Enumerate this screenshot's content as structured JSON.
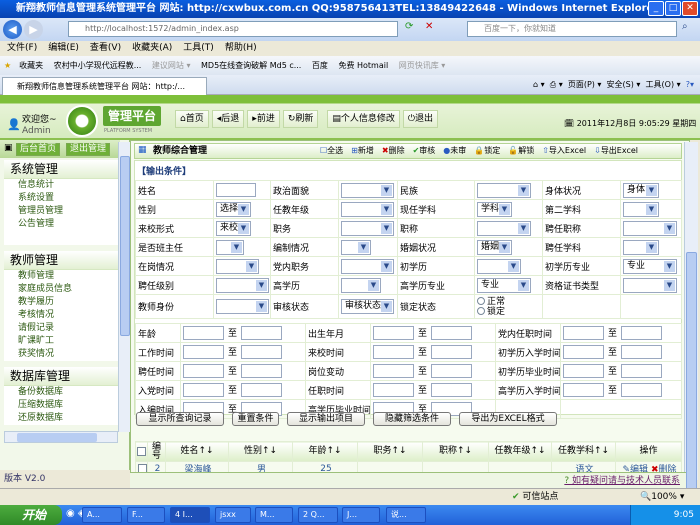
{
  "browser": {
    "title": "新翔教师信息管理系统管理平台 网站: http://cxwbux.com.cn QQ:958756413TEL:13849422648 - Windows Internet Explorer",
    "address": "http://localhost:1572/admin_index.asp",
    "search_placeholder": "百度一下，你就知道",
    "menu": [
      "文件(F)",
      "编辑(E)",
      "查看(V)",
      "收藏夹(A)",
      "工具(T)",
      "帮助(H)"
    ],
    "favorites": [
      "收藏夹",
      "农村中小学现代远程教...",
      "建议网站 ▾",
      "MD5在线查询破解 Md5 c...",
      "百度",
      "免费 Hotmail",
      "网页快讯库 ▾"
    ],
    "tab": "新翔教师信息管理系统管理平台 网站：http:/...",
    "tab_tools": [
      "页面(P) ▾",
      "安全(S) ▾",
      "工具(O) ▾"
    ],
    "status_zone": "可信站点",
    "zoom": "100%"
  },
  "header": {
    "welcome": "欢迎您~",
    "user": "Admin",
    "brand": "管理平台",
    "brand_sub": "PLATFORM SYSTEM",
    "nav": [
      "首页",
      "后退",
      "前进",
      "刷新",
      "个人信息修改",
      "退出"
    ],
    "datetime": "2011年12月8日 9:05:29 星期四"
  },
  "sidebar": {
    "buttons": [
      "后台首页",
      "退出管理"
    ],
    "groups": [
      {
        "title": "系统管理",
        "items": [
          "信息统计",
          "系统设置",
          "管理员管理",
          "公告管理"
        ]
      },
      {
        "title": "教师管理",
        "items": [
          "教师管理",
          "家庭成员信息",
          "教学履历",
          "考核情况",
          "请假记录",
          "旷课旷工",
          "获奖情况"
        ]
      },
      {
        "title": "数据库管理",
        "items": [
          "备份数据库",
          "压缩数据库",
          "还原数据库"
        ]
      },
      {
        "title": "系统日志",
        "items": []
      }
    ],
    "version": "版本 V2.0"
  },
  "main": {
    "title": "教师综合管理",
    "tools": [
      "全选",
      "新增",
      "删除",
      "审核",
      "未审",
      "锁定",
      "解锁",
      "导入Excel",
      "导出Excel"
    ],
    "cond_title": "【输出条件】",
    "rows": [
      [
        {
          "l": "姓名",
          "t": "text"
        },
        {
          "l": "政治面貌",
          "t": "select",
          "v": ""
        },
        {
          "l": "民族",
          "t": "select",
          "v": ""
        },
        {
          "l": "身体状况",
          "t": "select",
          "v": "身体"
        }
      ],
      [
        {
          "l": "性别",
          "t": "select",
          "v": "选择"
        },
        {
          "l": "任教年级",
          "t": "select",
          "v": ""
        },
        {
          "l": "现任学科",
          "t": "select",
          "v": "学科"
        },
        {
          "l": "第二学科",
          "t": "select",
          "v": ""
        }
      ],
      [
        {
          "l": "来校形式",
          "t": "select",
          "v": "来校"
        },
        {
          "l": "职务",
          "t": "select",
          "v": ""
        },
        {
          "l": "职称",
          "t": "select",
          "v": ""
        },
        {
          "l": "聘任职称",
          "t": "select",
          "v": ""
        }
      ],
      [
        {
          "l": "是否班主任",
          "t": "select",
          "v": ""
        },
        {
          "l": "编制情况",
          "t": "select",
          "v": ""
        },
        {
          "l": "婚姻状况",
          "t": "select",
          "v": "婚姻"
        },
        {
          "l": "聘任学科",
          "t": "select",
          "v": ""
        }
      ],
      [
        {
          "l": "在岗情况",
          "t": "select",
          "v": ""
        },
        {
          "l": "党内职务",
          "t": "select",
          "v": ""
        },
        {
          "l": "初学历",
          "t": "select",
          "v": ""
        },
        {
          "l": "初学历专业",
          "t": "select",
          "v": "专业"
        }
      ],
      [
        {
          "l": "聘任级别",
          "t": "select",
          "v": ""
        },
        {
          "l": "高学历",
          "t": "select",
          "v": ""
        },
        {
          "l": "高学历专业",
          "t": "select",
          "v": "专业"
        },
        {
          "l": "资格证书类型",
          "t": "select",
          "v": ""
        }
      ],
      [
        {
          "l": "教师身份",
          "t": "select",
          "v": ""
        },
        {
          "l": "审核状态",
          "t": "select",
          "v": "审核状态"
        },
        {
          "l": "锁定状态",
          "t": "radio",
          "options": [
            "正常",
            "锁定"
          ]
        },
        {
          "l": "",
          "t": "none"
        }
      ]
    ],
    "range_sep": "至",
    "ranges": [
      [
        "年龄",
        "出生年月",
        "党内任职时间"
      ],
      [
        "工作时间",
        "来校时间",
        "初学历入学时间"
      ],
      [
        "聘任时间",
        "岗位变动",
        "初学历毕业时间"
      ],
      [
        "入党时间",
        "任职时间",
        "高学历入学时间"
      ],
      [
        "入编时间",
        "高学历毕业时间",
        ""
      ]
    ],
    "buttons": [
      "显示所查询记录",
      "重置条件",
      "显示输出项目",
      "隐藏筛选条件",
      "导出为EXCEL格式"
    ],
    "table": {
      "headers": [
        "编号",
        "姓名↑↓",
        "性别↑↓",
        "年龄↑↓",
        "职务↑↓",
        "职称↑↓",
        "任教年级↑↓",
        "任教学科↑↓",
        "操作"
      ],
      "rows": [
        {
          "id": "2",
          "name": "梁海峰",
          "gender": "男",
          "age": "25",
          "duty": "",
          "title": "",
          "grade": "",
          "subject": "语文",
          "edit": "编辑",
          "del": "删除"
        }
      ]
    },
    "contact": "如有疑问请与技术人员联系"
  },
  "taskbar": {
    "start": "开始",
    "tasks": [
      "A...",
      "F...",
      "4 I...",
      "jsxx",
      "M...",
      "2 Q...",
      "J...",
      "说..."
    ],
    "clock": "9:05"
  }
}
